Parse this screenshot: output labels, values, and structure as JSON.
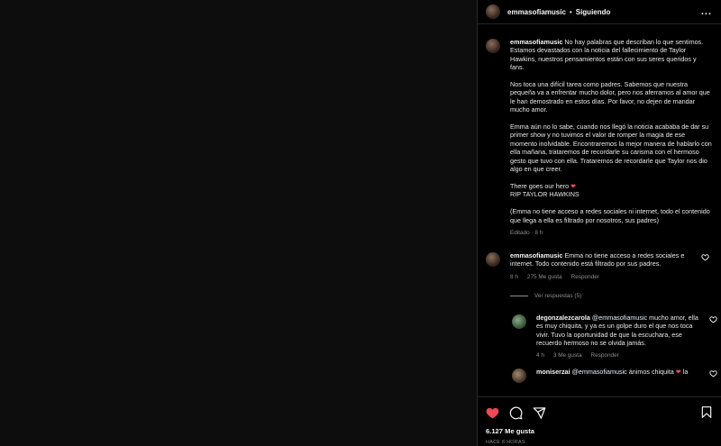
{
  "header": {
    "username": "emmasofiamusic",
    "separator": "•",
    "follow_status": "Siguiendo",
    "more": "..."
  },
  "caption": {
    "username": "emmasofiamusic",
    "text": " No hay palabras que describan lo que sentimos. Estamos devastados con la noticia del fallecimiento de Taylor Hawkins, nuestros pensamientos están con sus seres queridos y fans.\n\nNos toca una difícil tarea como padres. Sabemos que nuestra pequeña va a enfrentar mucho dolor, pero nos aferramos al amor que le han demostrado en estos días. Por favor, no dejen de mandar mucho amor.\n\nEmma aún no lo sabe, cuando nos llegó la noticia acababa de dar su primer show y no tuvimos el valor de romper la magia de ese momento inolvidable. Encontraremos la mejor manera de hablarlo con ella mañana, trataremos de recordarle su carisma con el hermoso gesto que tuvo con ella. Trataremos de recordarle que Taylor nos dio algo en que creer.\n\nThere goes our hero ",
    "heart": "❤",
    "text2": "\nRIP TAYLOR HAWKINS\n\n(Emma no tiene acceso a redes sociales ni internet, todo el contenido que llega a ella es filtrado por nosotros, sus padres)",
    "edited": "Editado · 8 h"
  },
  "comment1": {
    "username": "emmasofiamusic",
    "text": " Emma no tiene acceso a redes sociales e internet. Todo contenido está filtrado por sus padres.",
    "time": "8 h",
    "likes": "275 Me gusta",
    "reply": "Responder"
  },
  "view_replies": "Ver respuestas (5)",
  "reply1": {
    "username": "degonzalezcarola",
    "mention": "@emmasofiamusic",
    "text": " mucho amor, ella es muy chiquita, y ya es un golpe duro el que nos toca vivir. Tuvo la oportunidad de que la escuchara, ese recuerdo hermoso no se olvida jamás.",
    "time": "4 h",
    "likes": "3 Me gusta",
    "reply": "Responder"
  },
  "reply2": {
    "username": "moniserzai",
    "mention": "@emmasofiamusic",
    "text": " ánimos chiquita ",
    "heart": "❤",
    "text2": " la"
  },
  "actions": {
    "likes": "6.127 Me gusta",
    "time": "HACE 8 HORAS"
  },
  "colors": {
    "heart_red": "#ed4956",
    "muted": "#8e8e8e"
  }
}
